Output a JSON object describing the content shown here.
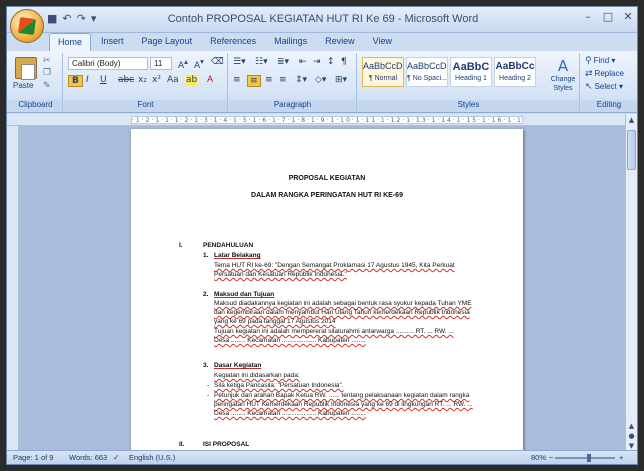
{
  "window": {
    "title": "Contoh PROPOSAL KEGIATAN HUT RI Ke 69 - Microsoft Word"
  },
  "quick_access": {
    "save_icon": "save-icon",
    "undo_icon": "undo-icon",
    "redo_icon": "redo-icon"
  },
  "tabs": [
    {
      "label": "Home",
      "active": true
    },
    {
      "label": "Insert"
    },
    {
      "label": "Page Layout"
    },
    {
      "label": "References"
    },
    {
      "label": "Mailings"
    },
    {
      "label": "Review"
    },
    {
      "label": "View"
    }
  ],
  "ribbon": {
    "clipboard": {
      "group_label": "Clipboard",
      "paste_label": "Paste"
    },
    "font": {
      "group_label": "Font",
      "font_name": "Calibri (Body)",
      "font_size": "11"
    },
    "paragraph": {
      "group_label": "Paragraph"
    },
    "styles": {
      "group_label": "Styles",
      "items": [
        {
          "preview": "AaBbCcDc",
          "name": "¶ Normal",
          "selected": true
        },
        {
          "preview": "AaBbCcDc",
          "name": "¶ No Spaci..."
        },
        {
          "preview": "AaBbC",
          "name": "Heading 1"
        },
        {
          "preview": "AaBbCc",
          "name": "Heading 2"
        }
      ],
      "change_styles_line1": "Change",
      "change_styles_line2": "Styles"
    },
    "editing": {
      "group_label": "Editing",
      "find": "Find",
      "replace": "Replace",
      "select": "Select"
    }
  },
  "document": {
    "title1": "PROPOSAL KEGIATAN",
    "title2": "DALAM RANGKA PERINGATAN HUT RI KE-69",
    "section1_num": "I.",
    "section1": "PENDAHULUAN",
    "item1_num": "1.",
    "item1": "Latar Belakang",
    "item1_text1": "Tema HUT RI ke-69: \"Dengan Semangat Proklamasi 17 Agustus 1945, Kita Perkuat",
    "item1_text2": "Persatuan dan Kesatuan Republik Indonesia.\"",
    "item2_num": "2.",
    "item2": "Maksud dan Tujuan",
    "item2_text1": "Maksud diadakannya kegiatan ini adalah sebagai bentuk rasa syukur kepada Tuhan YME",
    "item2_text2": "dan kegembiraan dalam menyambut Hari Ulang Tahun kemerdekaan Republik Indonesia",
    "item2_text3": "yang ke 69 pada tanggal 17 Agustus 2014",
    "item2_text4": "Tujuan kegiatan ini adalah mempererat silaturahmi antarwarga .......... RT. ... RW. ...",
    "item2_text5": "Desa ........ Kecamatan ................... Kabupaten ........",
    "item3_num": "3.",
    "item3": "Dasar Kegiatan",
    "item3_text1": "Kegiatan ini didasarkan pada:",
    "bullet1": "Sila ketiga Pancasila: \"Persatuan Indonesia\".",
    "bullet2_line1": "Petunjuk dan arahan Bapak Ketua RW. ...... tentang pelaksanaan kegiatan dalam rangka",
    "bullet2_line2": "peringatan HUT Kemerdekaan Republik Indonesia yang ke 69 di lingkungan RT. ... RW. ...",
    "bullet2_line3": "Desa ........ Kecamatan ................... Kabupaten ........",
    "section2_num": "II.",
    "section2": "ISI PROPOSAL"
  },
  "statusbar": {
    "page": "Page: 1 of 9",
    "words": "Words: 663",
    "language": "English (U.S.)",
    "zoom": "80%"
  }
}
